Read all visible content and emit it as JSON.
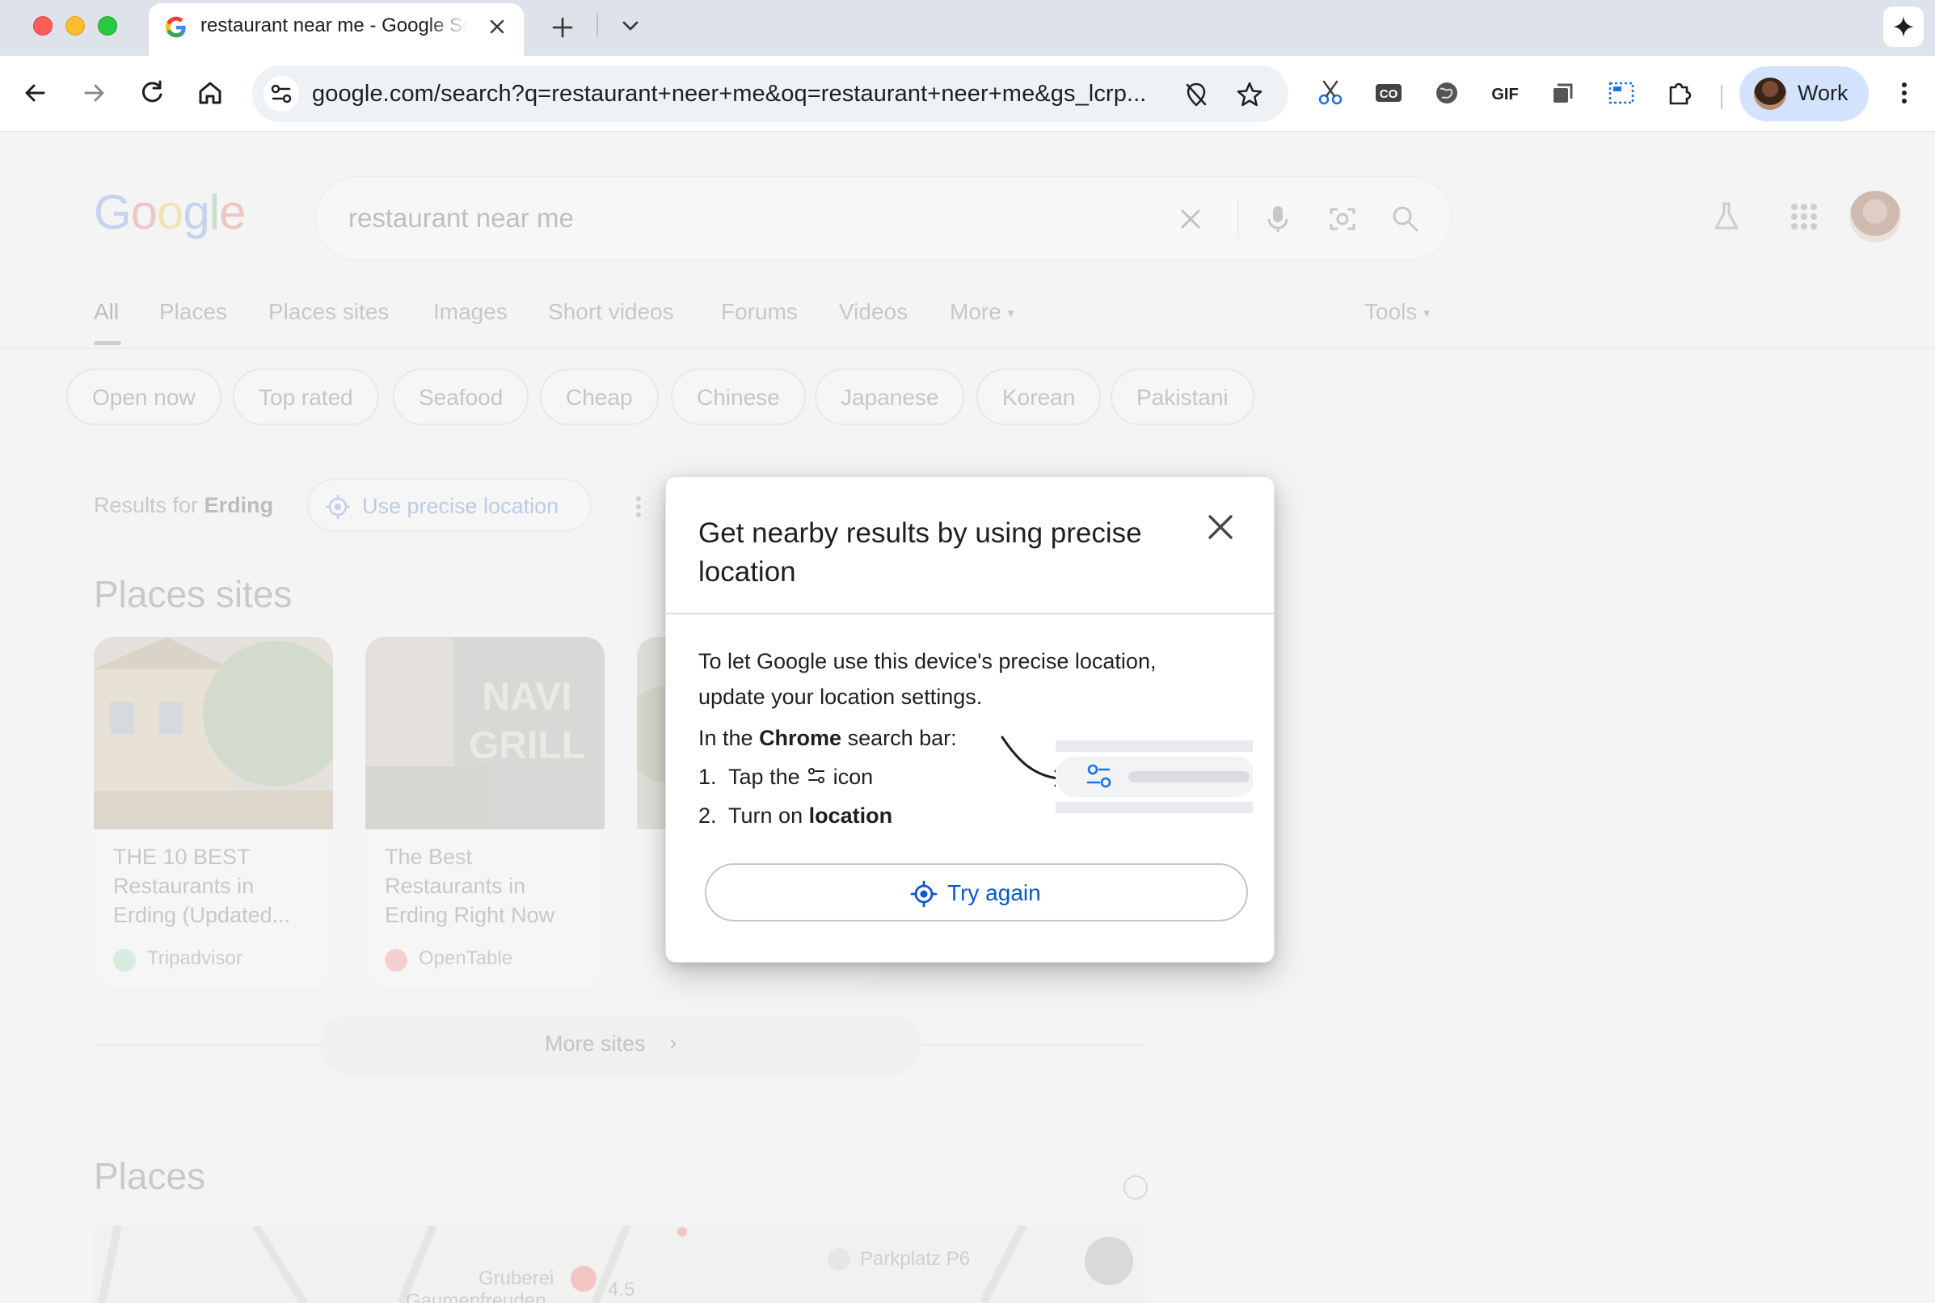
{
  "browser": {
    "tab_title": "restaurant near me - Google Search",
    "url": "google.com/search?q=restaurant+neer+me&oq=restaurant+neer+me&gs_lcrp...",
    "profile_label": "Work"
  },
  "search": {
    "logo": [
      "G",
      "o",
      "o",
      "g",
      "l",
      "e"
    ],
    "query": "restaurant near me",
    "tabs": [
      "All",
      "Places",
      "Places sites",
      "Images",
      "Short videos",
      "Forums",
      "Videos",
      "More"
    ],
    "tools_label": "Tools",
    "chips": [
      "Open now",
      "Top rated",
      "Seafood",
      "Cheap",
      "Chinese",
      "Japanese",
      "Korean",
      "Pakistani"
    ],
    "results_for_prefix": "Results for",
    "results_for_location": "Erding",
    "precise_location_label": "Use precise location"
  },
  "places_sites": {
    "title": "Places sites",
    "cards": [
      {
        "title": "THE 10 BEST Restaurants in Erding (Updated...",
        "source": "Tripadvisor"
      },
      {
        "title": "The Best Restaurants in Erding Right Now",
        "source": "OpenTable"
      }
    ],
    "more_sites_label": "More sites"
  },
  "places": {
    "title": "Places",
    "map_labels": [
      "Parkplatz P6",
      "Gruberei",
      "Gaumenfreuden",
      "4.5"
    ]
  },
  "dialog": {
    "title": "Get nearby results by using precise location",
    "body": "To let Google use this device's precise location, update your location settings.",
    "intro_prefix": "In the ",
    "intro_bold": "Chrome",
    "intro_suffix": " search bar:",
    "step1_prefix": "1.  Tap the ",
    "step1_suffix": " icon",
    "step2_prefix": "2.  Turn on ",
    "step2_bold": "location",
    "try_again_label": "Try again",
    "accent_color": "#0b57d0"
  }
}
